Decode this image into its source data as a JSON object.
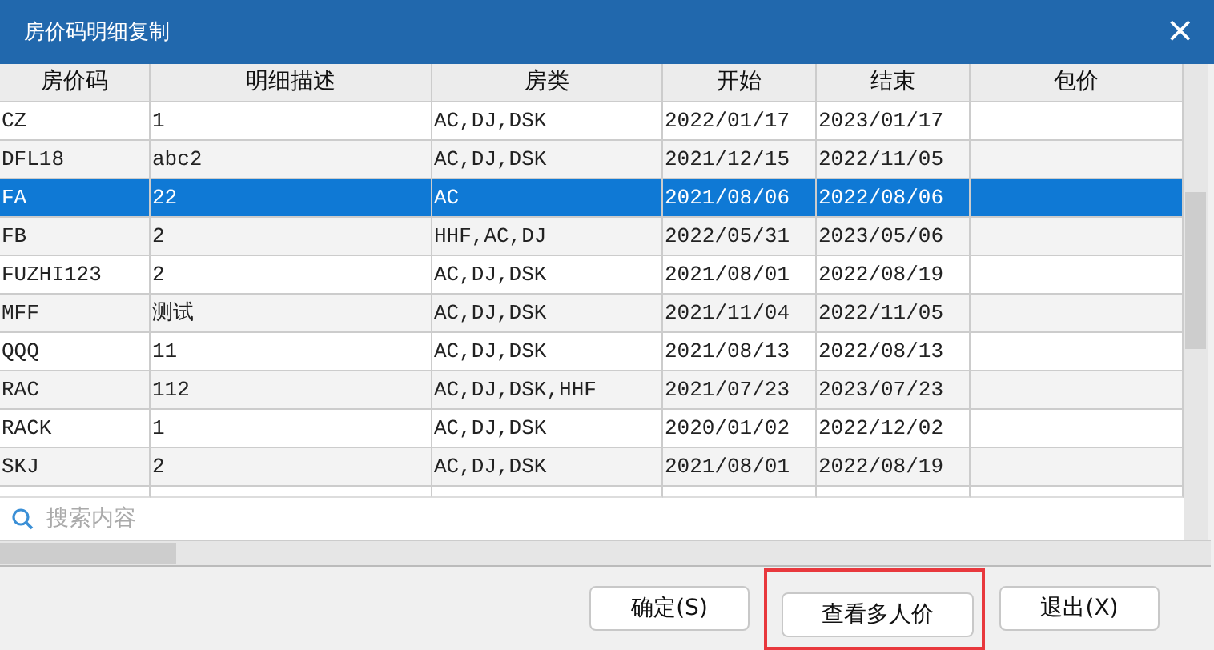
{
  "window": {
    "title": "房价码明细复制",
    "close": "×"
  },
  "table": {
    "columns": [
      "房价码",
      "明细描述",
      "房类",
      "开始",
      "结束",
      "包价"
    ],
    "rows": [
      {
        "cells": [
          "CZ",
          "1",
          "AC,DJ,DSK",
          "2022/01/17",
          "2023/01/17",
          ""
        ],
        "selected": false
      },
      {
        "cells": [
          "DFL18",
          "abc2",
          "AC,DJ,DSK",
          "2021/12/15",
          "2022/11/05",
          ""
        ],
        "selected": false
      },
      {
        "cells": [
          "FA",
          "22",
          "AC",
          "2021/08/06",
          "2022/08/06",
          ""
        ],
        "selected": true
      },
      {
        "cells": [
          "FB",
          "2",
          "HHF,AC,DJ",
          "2022/05/31",
          "2023/05/06",
          ""
        ],
        "selected": false
      },
      {
        "cells": [
          "FUZHI123",
          "2",
          "AC,DJ,DSK",
          "2021/08/01",
          "2022/08/19",
          ""
        ],
        "selected": false
      },
      {
        "cells": [
          "MFF",
          "测试",
          "AC,DJ,DSK",
          "2021/11/04",
          "2022/11/05",
          ""
        ],
        "selected": false
      },
      {
        "cells": [
          "QQQ",
          "11",
          "AC,DJ,DSK",
          "2021/08/13",
          "2022/08/13",
          ""
        ],
        "selected": false
      },
      {
        "cells": [
          "RAC",
          "112",
          "AC,DJ,DSK,HHF",
          "2021/07/23",
          "2023/07/23",
          ""
        ],
        "selected": false
      },
      {
        "cells": [
          "RACK",
          "1",
          "AC,DJ,DSK",
          "2020/01/02",
          "2022/12/02",
          ""
        ],
        "selected": false
      },
      {
        "cells": [
          "SKJ",
          "2",
          "AC,DJ,DSK",
          "2021/08/01",
          "2022/08/19",
          ""
        ],
        "selected": false
      }
    ]
  },
  "search": {
    "placeholder": "搜索内容"
  },
  "buttons": [
    {
      "label": "确定(S)",
      "highlighted": false
    },
    {
      "label": "查看多人价",
      "highlighted": true
    },
    {
      "label": "退出(X)",
      "highlighted": false
    }
  ]
}
